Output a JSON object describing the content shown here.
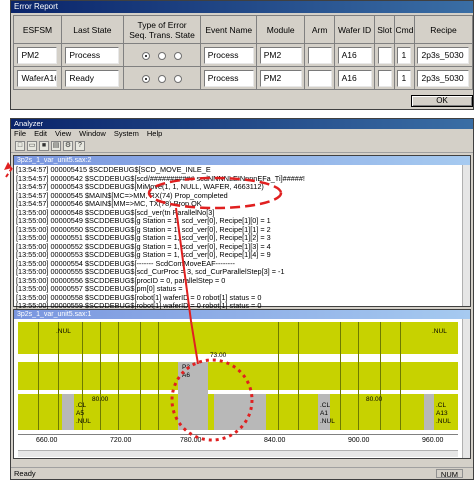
{
  "error_report": {
    "title": "Error Report",
    "headers": {
      "esfsm": "ESFSM",
      "last_state": "Last State",
      "type_of_error": "Type of Error",
      "seq_trans_state": "Seq. Trans. State",
      "event_name": "Event Name",
      "module": "Module",
      "arm": "Arm",
      "wafer_id": "Wafer ID",
      "slot": "Slot",
      "cmd": "Cmd",
      "recipe": "Recipe"
    },
    "rows": [
      {
        "esfsm": "PM2",
        "last_state": "Process",
        "event_name": "Process",
        "module": "PM2",
        "arm": "",
        "wafer_id": "A16",
        "slot": "",
        "cmd": "1",
        "recipe": "2p3s_5030"
      },
      {
        "esfsm": "WaferA16",
        "last_state": "Ready",
        "event_name": "Process",
        "module": "PM2",
        "arm": "",
        "wafer_id": "A16",
        "slot": "",
        "cmd": "1",
        "recipe": "2p3s_5030"
      }
    ],
    "ok_label": "OK"
  },
  "analyzer": {
    "title": "Analyzer",
    "menu": [
      "File",
      "Edit",
      "View",
      "Window",
      "System",
      "Help"
    ],
    "log_title": "3p2s_1_var_unit5.sax:2",
    "log_lines": [
      "[13:54:57] 000005415 $SCDDEBUG$[SCD_MOVE_INLE_E",
      "[13:54:57] 00000542 $SCDDEBUG$[scd/########### scdNNNNLEINnnnEFa_Ti]#####!",
      "[13:54:57] 00000543 $SCDDEBUG$[MiMove(1, 1, NULL, WAFER, 4663112)",
      "[13:54:57] 00000545 $MAIN$[MC=>MM, RX(74)  Prop_completed",
      "[13:54:57] 00000546 $MAIN$[MM=>MC, TX(78)  Prop OK",
      "[13:55:00] 00000548 $SCDDEBUG$[scd_ver(tn ParallelNo[3]",
      "[13:55:00] 00000549 $SCDDEBUG$[g Station = 1, scd_ver[0], Recipe[1][0] = 1",
      "[13:55:00] 00000550 $SCDDEBUG$[g Station = 1, scd_ver[0], Recipe[1][1] = 2",
      "[13:55:00] 00000551 $SCDDEBUG$[g Station = 1, scd_ver[0], Recipe[1][2] = 3",
      "[13:55:00] 00000552 $SCDDEBUG$[g Station = 1, scd_ver[0], Recipe[1][3] = 4",
      "[13:55:00] 00000553 $SCDDEBUG$[g Station = 1, scd_ver[0], Recipe[1][4] = 9",
      "[13:55:00] 00000554 $SCDDEBUG$[------- ScdComMoveEAF--------",
      "[13:55:00] 00000555 $SCDDEBUG$[scd_CurProc = 3, scd_CurParallelStep[3] = -1",
      "[13:55:00] 00000556 $SCDDEBUG$[procID = 0, parallelStep = 0",
      "[13:55:00] 00000557 $SCDDEBUG$[pm[0] status =",
      "[13:55:00] 00000558 $SCDDEBUG$[robot[1] waferID = 0  robot[1] status = 0",
      "[13:55:00] 00000559 $SCDDEBUG$[robot[1] waferID = 0  robot[1] status = 0"
    ],
    "timeline_title": "3p2s_1_var_unit5.sax:1",
    "timeline_labels": {
      "nul_top": ".NUL",
      "nul_right": ".NUL",
      "block_a": "P3",
      "block_b": "A6",
      "val_73": "73.00",
      "val_80_left": "80.00",
      "val_80_mid": "80.00",
      "cl_a": ".CL",
      "cl_b": ".CL",
      "cl_c": ".CL",
      "a5": "A5",
      "a1": "A1",
      "a13": "A13",
      "nul_a": ".NUL",
      "nul_b": ".NUL",
      "nul_c": ".NUL"
    },
    "axis_ticks": [
      "660.00",
      "720.00",
      "780.00",
      "840.00",
      "900.00",
      "960.00"
    ],
    "status_left": "Ready",
    "status_num": "NUM"
  },
  "colors": {
    "lane": "#c7d200",
    "annotation": "#e02020"
  },
  "icons": [
    "new-icon",
    "open-icon",
    "save-icon",
    "print-icon",
    "settings-icon",
    "help-icon"
  ]
}
